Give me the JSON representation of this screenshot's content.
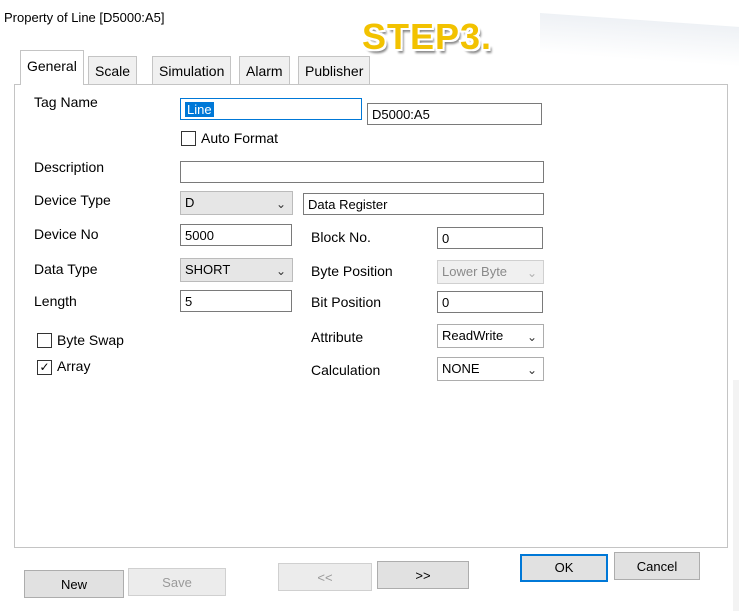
{
  "window": {
    "title": "Property of Line [D5000:A5]"
  },
  "overlay": {
    "step_label": "STEP3."
  },
  "tabs": [
    {
      "label": "General",
      "active": true
    },
    {
      "label": "Scale"
    },
    {
      "label": "Simulation"
    },
    {
      "label": "Alarm"
    },
    {
      "label": "Publisher"
    }
  ],
  "general": {
    "tag_name": {
      "label": "Tag Name",
      "value": "Line",
      "address": "D5000:A5"
    },
    "auto_format": {
      "label": "Auto Format",
      "checked": false
    },
    "description": {
      "label": "Description",
      "value": ""
    },
    "device_type": {
      "label": "Device Type",
      "value": "D",
      "description": "Data Register"
    },
    "device_no": {
      "label": "Device No",
      "value": "5000"
    },
    "block_no": {
      "label": "Block No.",
      "value": "0"
    },
    "data_type": {
      "label": "Data Type",
      "value": "SHORT"
    },
    "byte_position": {
      "label": "Byte Position",
      "value": "Lower Byte"
    },
    "length": {
      "label": "Length",
      "value": "5"
    },
    "bit_position": {
      "label": "Bit Position",
      "value": "0"
    },
    "byte_swap": {
      "label": "Byte Swap",
      "checked": false
    },
    "array": {
      "label": "Array",
      "checked": true
    },
    "attribute": {
      "label": "Attribute",
      "value": "ReadWrite"
    },
    "calculation": {
      "label": "Calculation",
      "value": "NONE"
    }
  },
  "buttons": {
    "new": "New",
    "save": "Save",
    "prev": "<<",
    "next": ">>",
    "ok": "OK",
    "cancel": "Cancel"
  },
  "icons": {
    "dropdown": "chevron-down-icon",
    "check": "checkmark-icon"
  },
  "colors": {
    "accent": "#0078d7",
    "step_label": "#f2c200"
  }
}
